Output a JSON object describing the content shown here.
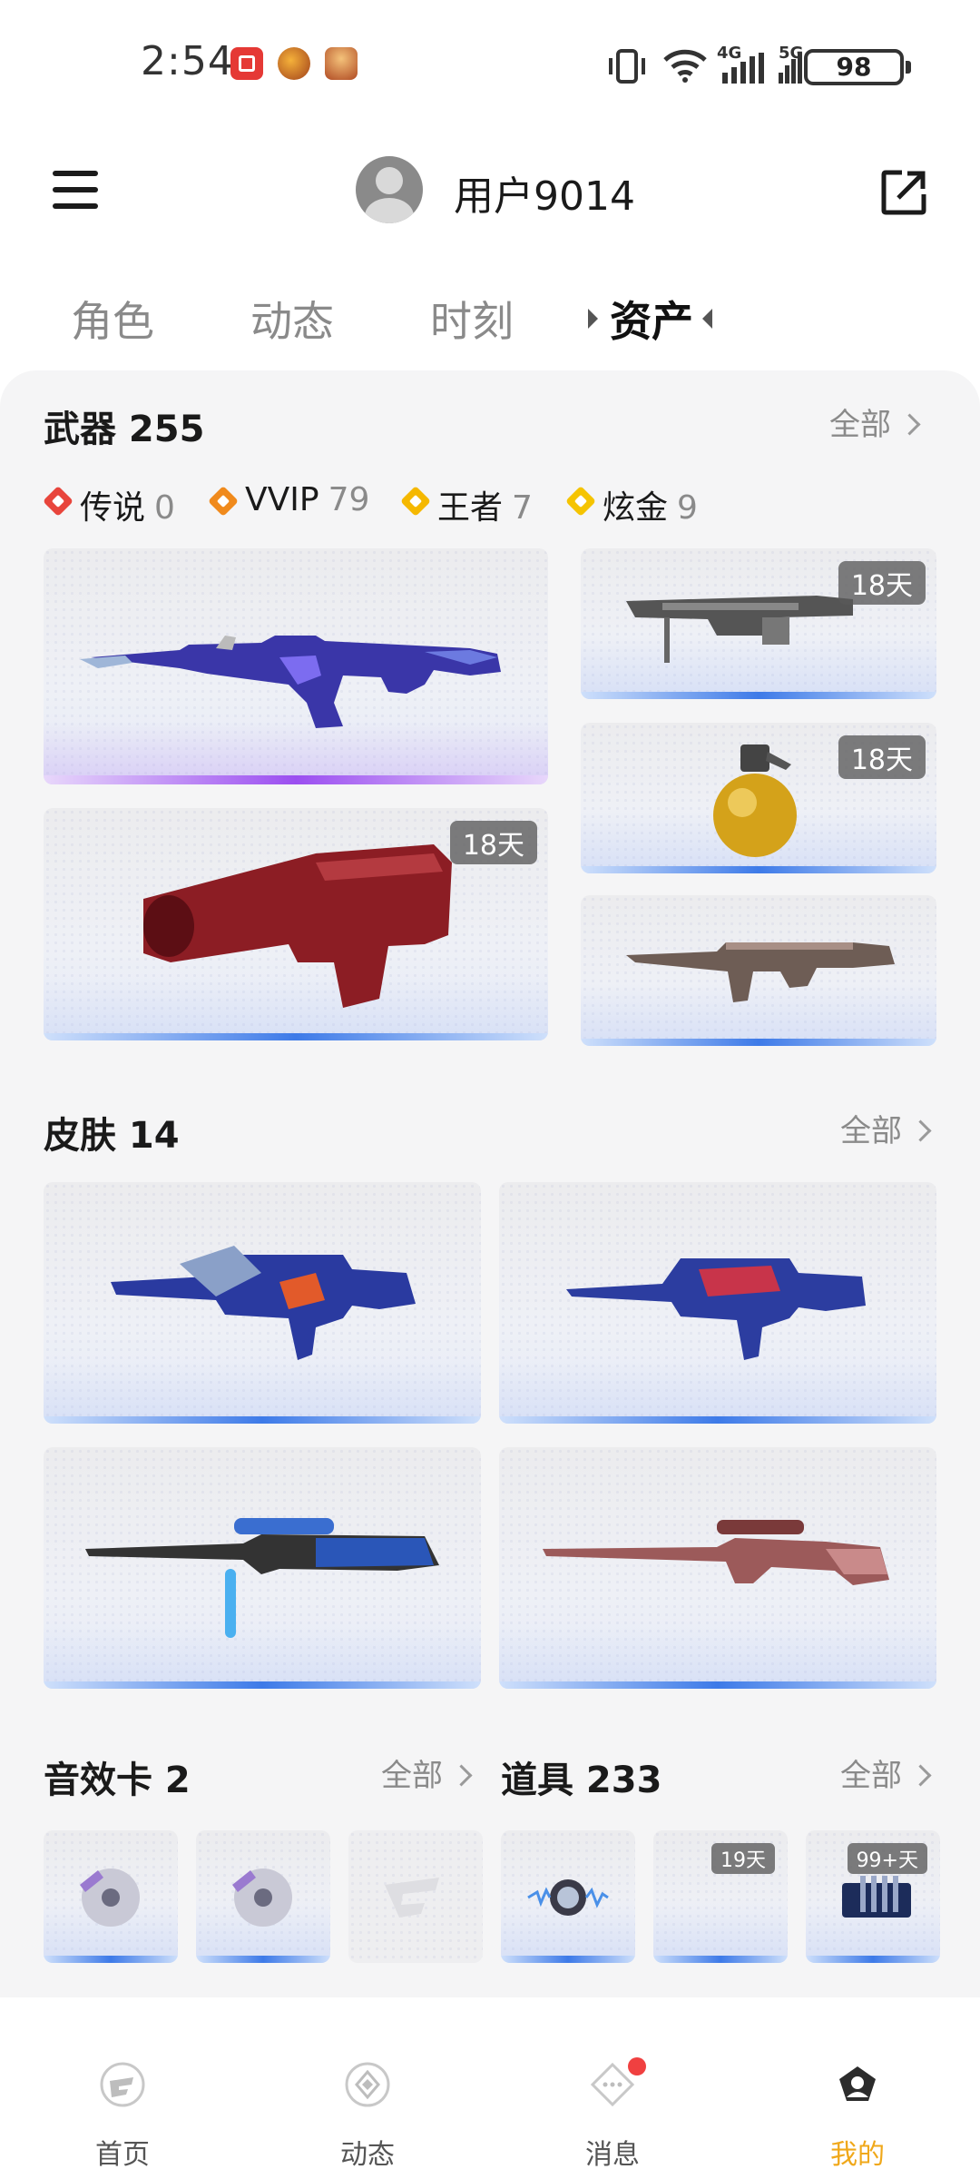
{
  "status_bar": {
    "time": "2:54",
    "battery": "98",
    "network1": "4G",
    "network2": "5G"
  },
  "header": {
    "username": "用户9014",
    "menu_icon": "menu-icon",
    "share_icon": "share-icon"
  },
  "tabs": [
    {
      "label": "角色",
      "active": false
    },
    {
      "label": "动态",
      "active": false
    },
    {
      "label": "时刻",
      "active": false
    },
    {
      "label": "资产",
      "active": true
    }
  ],
  "weapons": {
    "title": "武器 255",
    "all_label": "全部",
    "rarities": [
      {
        "label": "传说",
        "count": "0",
        "color": "#e8453c"
      },
      {
        "label": "VVIP",
        "count": "79",
        "color": "#f08a1c"
      },
      {
        "label": "王者",
        "count": "7",
        "color": "#f5b800"
      },
      {
        "label": "炫金",
        "count": "9",
        "color": "#f5c400"
      }
    ],
    "items": [
      {
        "name": "ak-rifle",
        "badge": ""
      },
      {
        "name": "machine-gun",
        "badge": "18天"
      },
      {
        "name": "grenade",
        "badge": "18天"
      },
      {
        "name": "red-smg",
        "badge": "18天"
      },
      {
        "name": "scar-rifle",
        "badge": ""
      }
    ]
  },
  "skins": {
    "title": "皮肤 14",
    "all_label": "全部",
    "items": [
      {
        "name": "m4-dragon-skin"
      },
      {
        "name": "m4-blue-skin"
      },
      {
        "name": "sniper-blue-skin"
      },
      {
        "name": "awm-rose-skin"
      }
    ]
  },
  "sound_cards": {
    "title": "音效卡 2",
    "all_label": "全部",
    "items": [
      {
        "badge": ""
      },
      {
        "badge": ""
      },
      {
        "badge": ""
      }
    ]
  },
  "props": {
    "title": "道具 233",
    "all_label": "全部",
    "items": [
      {
        "badge": ""
      },
      {
        "badge": "19天"
      },
      {
        "badge": "99+天"
      }
    ]
  },
  "bottom_nav": [
    {
      "label": "首页",
      "icon": "home-icon",
      "active": false
    },
    {
      "label": "动态",
      "icon": "feed-icon",
      "active": false
    },
    {
      "label": "消息",
      "icon": "message-icon",
      "active": false
    },
    {
      "label": "我的",
      "icon": "profile-icon",
      "active": true
    }
  ],
  "colors": {
    "accent": "#f0a81a",
    "blue_bar": "#3d7ae8",
    "purple_bar": "#9b4ef0"
  }
}
